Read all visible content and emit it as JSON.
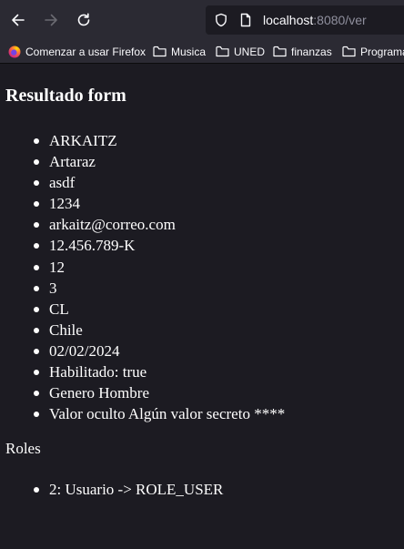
{
  "browser": {
    "url_host": "localhost",
    "url_rest": ":8080/ver",
    "bookmarks": [
      {
        "label": "Comenzar a usar Firefox",
        "icon": "firefox-icon"
      },
      {
        "label": "Musica",
        "icon": "folder-icon"
      },
      {
        "label": "UNED",
        "icon": "folder-icon"
      },
      {
        "label": "finanzas",
        "icon": "folder-icon"
      },
      {
        "label": "Programa",
        "icon": "folder-icon"
      }
    ]
  },
  "page": {
    "title": "Resultado form",
    "items": [
      "ARKAITZ",
      "Artaraz",
      "asdf",
      "1234",
      "arkaitz@correo.com",
      "12.456.789-K",
      "12",
      "3",
      "CL",
      "Chile",
      "02/02/2024",
      "Habilitado: true",
      "Genero Hombre",
      "Valor oculto Algún valor secreto ****"
    ],
    "roles_title": "Roles",
    "roles": [
      "2: Usuario -> ROLE_USER"
    ]
  },
  "colors": {
    "page_bg": "#1c1b22",
    "toolbar_bg": "#2b2a33",
    "text": "#fbfbfe",
    "muted": "#8f8f9d"
  }
}
